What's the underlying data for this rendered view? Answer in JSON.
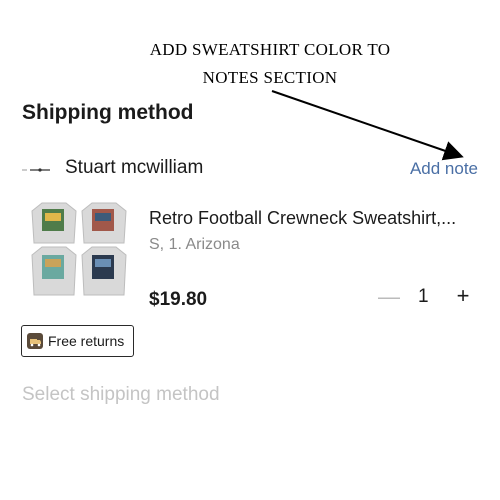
{
  "annotation": {
    "line1": "ADD SWEATSHIRT  COLOR TO",
    "line2": "NOTES  SECTION"
  },
  "shipping": {
    "title": "Shipping method",
    "seller_name": "Stuart mcwilliam",
    "add_note_label": "Add note",
    "product": {
      "title": "Retro Football Crewneck Sweatshirt,...",
      "variant": "S, 1. Arizona",
      "price": "$19.80",
      "quantity": "1",
      "minus_symbol": "—",
      "plus_symbol": "+"
    },
    "free_returns_label": "Free returns",
    "select_shipping_label": "Select shipping method"
  },
  "colors": {
    "link_blue": "#4a6fa5",
    "muted_text": "#8a8a8a",
    "disabled_text": "#c4c4c4"
  }
}
